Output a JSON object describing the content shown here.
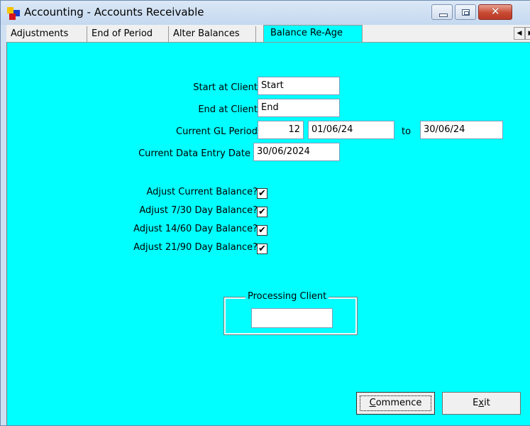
{
  "window": {
    "title": "Accounting - Accounts Receivable",
    "buttons": {
      "minimize": "minimize-icon",
      "maximize": "maximize-icon",
      "close": "close-icon"
    }
  },
  "tabs": [
    {
      "label": "Adjustments",
      "active": false
    },
    {
      "label": "End of Period",
      "active": false
    },
    {
      "label": "Alter Balances",
      "active": false
    },
    {
      "label": "Balance Re-Age",
      "active": true
    }
  ],
  "tab_scroll": {
    "left": "◀",
    "right": "▶"
  },
  "form": {
    "start_label": "Start at Client",
    "start_value": "Start",
    "end_label": "End at Client",
    "end_value": "End",
    "gl_label": "Current GL Period",
    "gl_period": "12",
    "gl_from": "01/06/24",
    "gl_to_label": "to",
    "gl_to": "30/06/24",
    "entry_date_label": "Current Data Entry Date",
    "entry_date_value": "30/06/2024"
  },
  "checks": [
    {
      "label": "Adjust Current Balance?",
      "checked": true
    },
    {
      "label": "Adjust 7/30 Day Balance?",
      "checked": true
    },
    {
      "label": "Adjust 14/60 Day Balance?",
      "checked": true
    },
    {
      "label": "Adjust 21/90 Day Balance?",
      "checked": true
    }
  ],
  "check_mark": "✔",
  "processing": {
    "legend": "Processing Client",
    "value": ""
  },
  "buttons": {
    "commence_first": "C",
    "commence_rest": "ommence",
    "exit_first": "E",
    "exit_underlined": "x",
    "exit_rest": "it"
  },
  "colors": {
    "panel": "#00ffff",
    "title_bar": "#cfe0f3",
    "close_button": "#c94a33"
  }
}
